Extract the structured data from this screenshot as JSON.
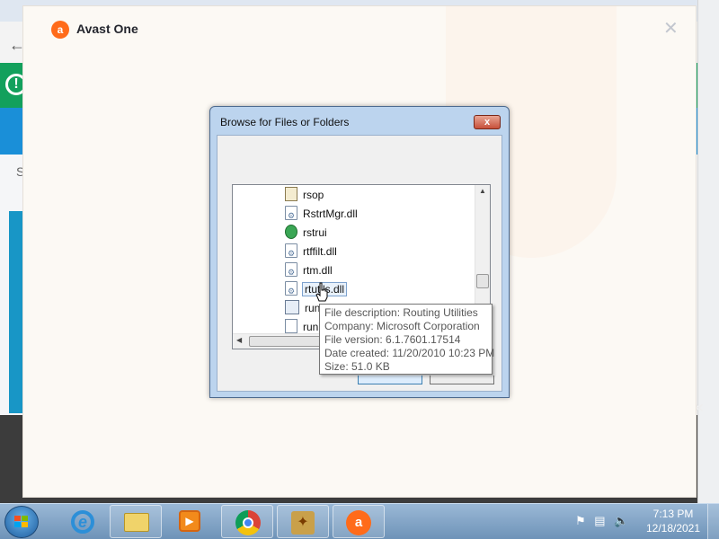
{
  "avast": {
    "title": "Avast One"
  },
  "background": {
    "partial_label": "S"
  },
  "dialog": {
    "title": "Browse for Files or Folders",
    "close_label": "x",
    "items": [
      {
        "name": "rsop",
        "icon": "script-icon"
      },
      {
        "name": "RstrtMgr.dll",
        "icon": "dll-file-icon"
      },
      {
        "name": "rstrui",
        "icon": "system-restore-icon"
      },
      {
        "name": "rtffilt.dll",
        "icon": "dll-file-icon"
      },
      {
        "name": "rtm.dll",
        "icon": "dll-file-icon"
      },
      {
        "name": "rtutils.dll",
        "icon": "dll-file-icon",
        "selected": true
      },
      {
        "name": "run",
        "icon": "executable-icon"
      },
      {
        "name": "run",
        "icon": "document-icon"
      }
    ]
  },
  "tooltip": {
    "description": "File description: Routing Utilities",
    "company": "Company: Microsoft Corporation",
    "version": "File version: 6.1.7601.17514",
    "created": "Date created: 11/20/2010 10:23 PM",
    "size": "Size: 51.0 KB"
  },
  "taskbar": {
    "ie_label": "e",
    "apps": [
      "internet-explorer",
      "windows-explorer",
      "windows-media-player",
      "google-chrome",
      "setup",
      "avast-one"
    ]
  },
  "clock": {
    "time": "7:13 PM",
    "date": "12/18/2021"
  },
  "colors": {
    "avast_orange": "#ff6b1a",
    "taskbar": "#7fa2c6",
    "dialog_frame": "#bcd4ee"
  }
}
